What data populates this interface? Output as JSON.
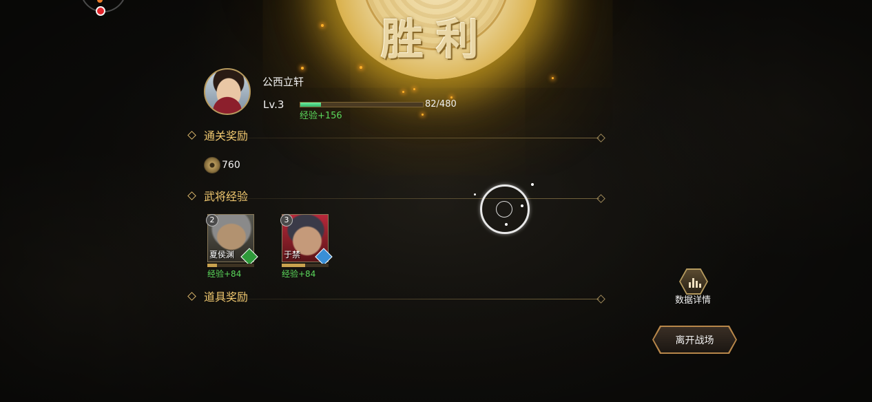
{
  "banner": {
    "title": "胜利"
  },
  "player": {
    "name": "公西立轩",
    "level": "Lv.3",
    "exp_current": 82,
    "exp_max": 480,
    "exp_text": "82/480",
    "exp_gain": "经验+156"
  },
  "sections": {
    "clear_rewards": "通关奖励",
    "general_exp": "武将经验",
    "item_rewards": "道具奖励"
  },
  "currency": {
    "value": "760",
    "icon": "copper-coin-icon"
  },
  "heroes": [
    {
      "name": "夏侯渊",
      "rank": "2",
      "exp_gain": "经验+84",
      "exp_fraction": 0.2,
      "gem_color": "#2e9a3a",
      "gem_icon": "green-gem-icon"
    },
    {
      "name": "于禁",
      "rank": "3",
      "exp_gain": "经验+84",
      "exp_fraction": 0.5,
      "gem_color": "#3a8fd6",
      "gem_icon": "blue-gem-icon"
    }
  ],
  "buttons": {
    "data_detail": "数据详情",
    "leave_battle": "离开战场"
  },
  "colors": {
    "accent": "#f0c870",
    "exp_green": "#5bd85b"
  }
}
